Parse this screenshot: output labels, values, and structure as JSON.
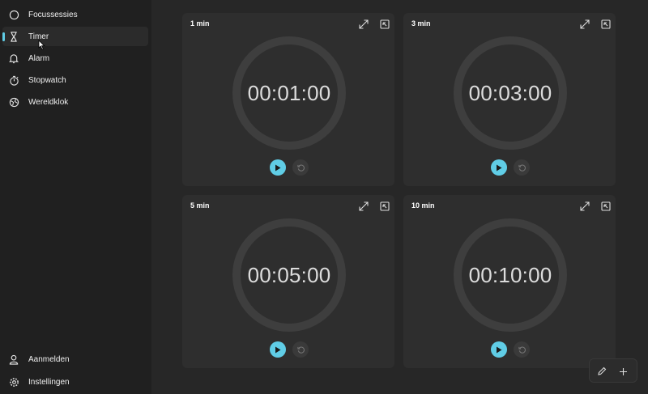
{
  "sidebar": {
    "items": [
      {
        "label": "Focussessies",
        "icon": "focus-icon"
      },
      {
        "label": "Timer",
        "icon": "hourglass-icon",
        "active": true
      },
      {
        "label": "Alarm",
        "icon": "bell-icon"
      },
      {
        "label": "Stopwatch",
        "icon": "stopwatch-icon"
      },
      {
        "label": "Wereldklok",
        "icon": "globe-icon"
      }
    ],
    "footer": [
      {
        "label": "Aanmelden",
        "icon": "person-icon"
      },
      {
        "label": "Instellingen",
        "icon": "gear-icon"
      }
    ]
  },
  "timers": [
    {
      "title": "1 min",
      "time": "00:01:00"
    },
    {
      "title": "3 min",
      "time": "00:03:00"
    },
    {
      "title": "5 min",
      "time": "00:05:00"
    },
    {
      "title": "10 min",
      "time": "00:10:00"
    }
  ],
  "colors": {
    "accent": "#60cde6",
    "background": "#202020",
    "card": "#2e2e2e"
  }
}
